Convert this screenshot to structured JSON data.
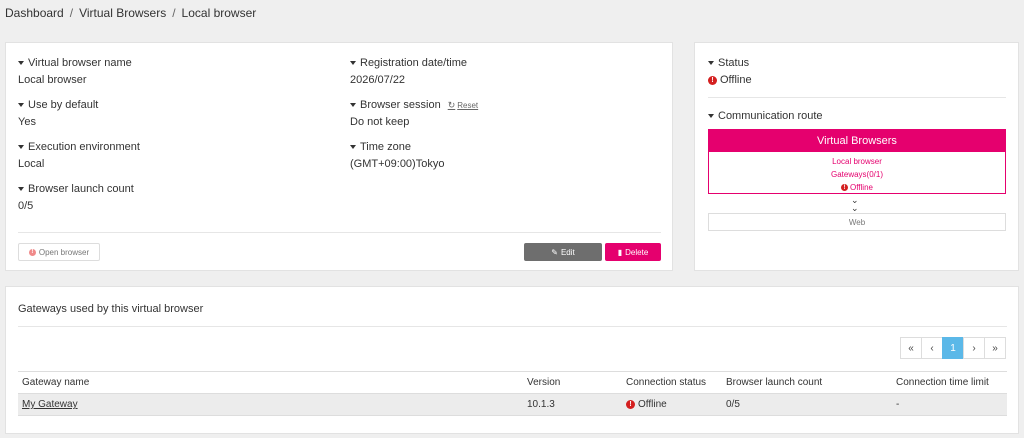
{
  "breadcrumb": {
    "items": [
      "Dashboard",
      "Virtual Browsers",
      "Local browser"
    ],
    "separator": "/"
  },
  "info": {
    "fields": [
      {
        "label": "Virtual browser name",
        "value": "Local browser"
      },
      {
        "label": "Use by default",
        "value": "Yes"
      },
      {
        "label": "Execution environment",
        "value": "Local"
      },
      {
        "label": "Browser launch count",
        "value": "0/5"
      },
      {
        "label": "Registration date/time",
        "value": "2026/07/22"
      },
      {
        "label": "Browser session",
        "value": "Do not keep",
        "action": "Reset"
      },
      {
        "label": "Time zone",
        "value": "(GMT+09:00)Tokyo"
      }
    ],
    "buttons": {
      "open": "Open browser",
      "edit": "Edit",
      "delete": "Delete"
    }
  },
  "status_panel": {
    "status_label": "Status",
    "status_value": "Offline",
    "route_label": "Communication route",
    "route": {
      "header": "Virtual Browsers",
      "browser": "Local browser",
      "gateways": "Gateways(0/1)",
      "status": "Offline",
      "web": "Web"
    }
  },
  "gateways": {
    "title": "Gateways used by this virtual browser",
    "pagination": {
      "first": "«",
      "prev": "‹",
      "current": "1",
      "next": "›",
      "last": "»"
    },
    "columns": [
      "Gateway name",
      "Version",
      "Connection status",
      "Browser launch count",
      "Connection time limit"
    ],
    "rows": [
      {
        "name": "My Gateway",
        "version": "10.1.3",
        "status": "Offline",
        "launch_count": "0/5",
        "time_limit": "-"
      }
    ]
  },
  "colors": {
    "accent": "#e5006e",
    "error": "#d42020",
    "pager_active": "#5bb8e8",
    "edit_button": "#6e6e6e"
  }
}
